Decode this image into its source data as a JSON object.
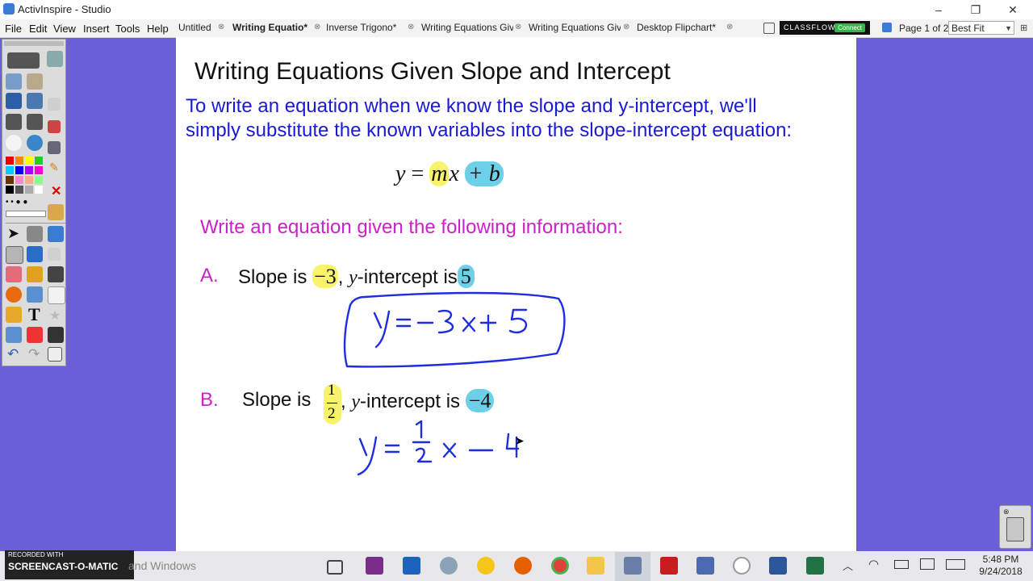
{
  "window": {
    "title": "ActivInspire - Studio",
    "minimize": "–",
    "restore": "❐",
    "close": "✕"
  },
  "menu": [
    "File",
    "Edit",
    "View",
    "Insert",
    "Tools",
    "Help"
  ],
  "tabs": [
    "Untitled",
    "Writing Equatio*",
    "Inverse Trigono*",
    "Writing Equations Given",
    "Writing Equations Given",
    "Desktop Flipchart*"
  ],
  "classflow": {
    "label": "CLASSFLOW",
    "connect": "Connect"
  },
  "page_info": "Page 1 of 2",
  "zoom": "Best Fit",
  "flipchart": {
    "heading": "Writing Equations Given Slope and Intercept",
    "intro_line1": "To write an equation when we know the slope and y-intercept, we'll",
    "intro_line2": "simply substitute the known variables into the slope-intercept equation:",
    "formula": {
      "y": "y",
      "eq": " = ",
      "m": "m",
      "x": "x",
      "plus_b": "+ b"
    },
    "prompt": "Write an equation given the following information:",
    "problem_a": {
      "letter": "A.",
      "text1": "Slope is ",
      "slope": "−3",
      "text2": ", ",
      "yvar": "y",
      "text3": "-intercept is",
      "intercept": "5"
    },
    "problem_b": {
      "letter": "B.",
      "text1": "Slope is ",
      "slope_num": "1",
      "slope_den": "2",
      "text2": ", ",
      "yvar": "y",
      "text3": "-intercept is ",
      "intercept": "−4"
    }
  },
  "colors": {
    "heading": "#111111",
    "intro": "#1a1ad6",
    "prompt": "#cc21c6",
    "highlight_yellow": "#f8f36a",
    "highlight_blue": "#6ed0e8",
    "ink": "#1f2de0",
    "background": "#6b5fd8"
  },
  "taskbar": {
    "watermark_top": "RECORDED WITH",
    "watermark_brand": "SCREENCAST-O-MATIC",
    "search_fragment": "and Windows",
    "time": "5:48 PM",
    "date": "9/24/2018"
  }
}
